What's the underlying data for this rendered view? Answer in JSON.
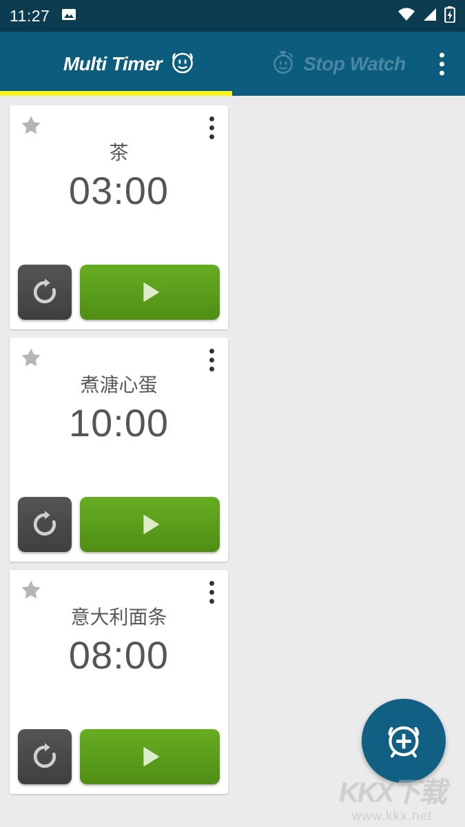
{
  "status_bar": {
    "time": "11:27",
    "icons": [
      "image-icon",
      "wifi-icon",
      "cellular-signal-icon",
      "battery-charging-icon"
    ],
    "background_color": "#0b3c4f"
  },
  "app_bar": {
    "background_color": "#0b5c7d",
    "accent_color": "#f6f61e",
    "overflow_label": "more-options",
    "tabs": [
      {
        "label": "Multi Timer",
        "icon": "alarm-clock-face-icon",
        "active": true
      },
      {
        "label": "Stop Watch",
        "icon": "stopwatch-face-icon",
        "active": false
      }
    ]
  },
  "timers": [
    {
      "title": "茶",
      "time": "03:00",
      "favorite": false,
      "reset_label": "reset",
      "start_label": "start"
    },
    {
      "title": "煮溏心蛋",
      "time": "10:00",
      "favorite": false,
      "reset_label": "reset",
      "start_label": "start"
    },
    {
      "title": "意大利面条",
      "time": "08:00",
      "favorite": false,
      "reset_label": "reset",
      "start_label": "start"
    }
  ],
  "fab": {
    "label": "add-timer",
    "icon": "alarm-add-icon",
    "color": "#125f84"
  },
  "watermark": {
    "logo": "KKX下载",
    "url": "www.kkx.net"
  },
  "colors": {
    "page_background": "#ebebeb",
    "card_background": "#ffffff",
    "start_green": "#5a9e18",
    "reset_gray": "#4a4a4a",
    "text_gray": "#555555",
    "star_gray": "#b5b5b5"
  }
}
